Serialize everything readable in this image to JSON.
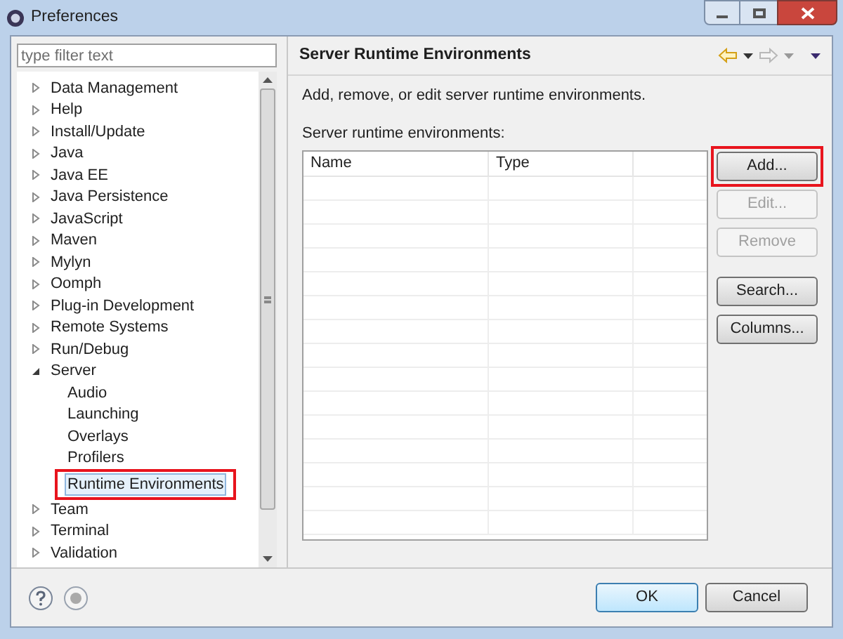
{
  "window": {
    "title": "Preferences"
  },
  "filter": {
    "placeholder": "type filter text"
  },
  "tree": [
    {
      "label": "Data Management",
      "expanded": false,
      "selected": false
    },
    {
      "label": "Help",
      "expanded": false,
      "selected": false
    },
    {
      "label": "Install/Update",
      "expanded": false,
      "selected": false
    },
    {
      "label": "Java",
      "expanded": false,
      "selected": false
    },
    {
      "label": "Java EE",
      "expanded": false,
      "selected": false
    },
    {
      "label": "Java Persistence",
      "expanded": false,
      "selected": false
    },
    {
      "label": "JavaScript",
      "expanded": false,
      "selected": false
    },
    {
      "label": "Maven",
      "expanded": false,
      "selected": false
    },
    {
      "label": "Mylyn",
      "expanded": false,
      "selected": false
    },
    {
      "label": "Oomph",
      "expanded": false,
      "selected": false
    },
    {
      "label": "Plug-in Development",
      "expanded": false,
      "selected": false
    },
    {
      "label": "Remote Systems",
      "expanded": false,
      "selected": false
    },
    {
      "label": "Run/Debug",
      "expanded": false,
      "selected": false
    },
    {
      "label": "Server",
      "expanded": true,
      "selected": false,
      "children": [
        {
          "label": "Audio",
          "selected": false
        },
        {
          "label": "Launching",
          "selected": false
        },
        {
          "label": "Overlays",
          "selected": false
        },
        {
          "label": "Profilers",
          "selected": false
        },
        {
          "label": "Runtime Environments",
          "selected": true,
          "highlighted": true
        }
      ]
    },
    {
      "label": "Team",
      "expanded": false,
      "selected": false
    },
    {
      "label": "Terminal",
      "expanded": false,
      "selected": false
    },
    {
      "label": "Validation",
      "expanded": false,
      "selected": false
    }
  ],
  "page": {
    "title": "Server Runtime Environments",
    "description": "Add, remove, or edit server runtime environments.",
    "table_label": "Server runtime environments:"
  },
  "table": {
    "columns": [
      "Name",
      "Type"
    ]
  },
  "side_buttons": [
    {
      "label": "Add...",
      "disabled": false,
      "highlighted": true
    },
    {
      "label": "Edit...",
      "disabled": true,
      "highlighted": false
    },
    {
      "label": "Remove",
      "disabled": true,
      "highlighted": false
    },
    {
      "label": "Search...",
      "disabled": false,
      "highlighted": false
    },
    {
      "label": "Columns...",
      "disabled": false,
      "highlighted": false
    }
  ],
  "footer_buttons": [
    {
      "label": "OK",
      "default": true
    },
    {
      "label": "Cancel",
      "default": false
    }
  ]
}
